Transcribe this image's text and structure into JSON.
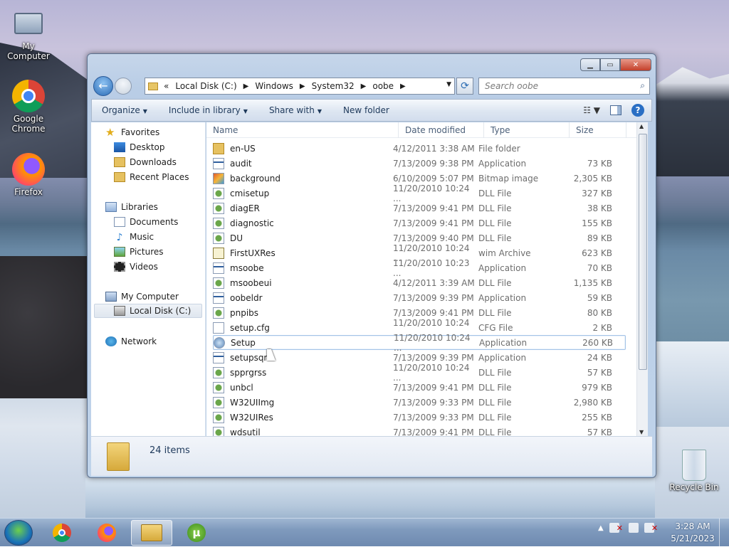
{
  "desktop": {
    "icons": [
      {
        "label": "My Computer",
        "icon": "computer-icon"
      },
      {
        "label": "Google\nChrome",
        "icon": "chrome-icon"
      },
      {
        "label": "Firefox",
        "icon": "firefox-icon"
      },
      {
        "label": "Recycle Bin",
        "icon": "recycle-bin-icon"
      }
    ]
  },
  "window": {
    "caption_buttons": [
      "minimize",
      "maximize",
      "close"
    ],
    "address": {
      "prefix": "«",
      "crumbs": [
        "Local Disk (C:)",
        "Windows",
        "System32",
        "oobe"
      ]
    },
    "search": {
      "placeholder": "Search oobe"
    },
    "toolbar": {
      "organize": "Organize",
      "include_in_library": "Include in library",
      "share_with": "Share with",
      "new_folder": "New folder"
    },
    "nav": {
      "favorites": "Favorites",
      "desktop": "Desktop",
      "downloads": "Downloads",
      "recent_places": "Recent Places",
      "libraries": "Libraries",
      "documents": "Documents",
      "music": "Music",
      "pictures": "Pictures",
      "videos": "Videos",
      "my_computer": "My Computer",
      "local_disk": "Local Disk (C:)",
      "network": "Network"
    },
    "columns": {
      "name": "Name",
      "date": "Date modified",
      "type": "Type",
      "size": "Size"
    },
    "files": [
      {
        "name": "en-US",
        "date": "4/12/2011 3:38 AM",
        "type": "File folder",
        "size": "",
        "icon": "folder"
      },
      {
        "name": "audit",
        "date": "7/13/2009 9:38 PM",
        "type": "Application",
        "size": "73 KB",
        "icon": "app"
      },
      {
        "name": "background",
        "date": "6/10/2009 5:07 PM",
        "type": "Bitmap image",
        "size": "2,305 KB",
        "icon": "bmp"
      },
      {
        "name": "cmisetup",
        "date": "11/20/2010 10:24 ...",
        "type": "DLL File",
        "size": "327 KB",
        "icon": "dll"
      },
      {
        "name": "diagER",
        "date": "7/13/2009 9:41 PM",
        "type": "DLL File",
        "size": "38 KB",
        "icon": "dll"
      },
      {
        "name": "diagnostic",
        "date": "7/13/2009 9:41 PM",
        "type": "DLL File",
        "size": "155 KB",
        "icon": "dll"
      },
      {
        "name": "DU",
        "date": "7/13/2009 9:40 PM",
        "type": "DLL File",
        "size": "89 KB",
        "icon": "dll"
      },
      {
        "name": "FirstUXRes",
        "date": "11/20/2010 10:24 ...",
        "type": "wim Archive",
        "size": "623 KB",
        "icon": "wim"
      },
      {
        "name": "msoobe",
        "date": "11/20/2010 10:23 ...",
        "type": "Application",
        "size": "70 KB",
        "icon": "app"
      },
      {
        "name": "msoobeui",
        "date": "4/12/2011 3:39 AM",
        "type": "DLL File",
        "size": "1,135 KB",
        "icon": "dll"
      },
      {
        "name": "oobeldr",
        "date": "7/13/2009 9:39 PM",
        "type": "Application",
        "size": "59 KB",
        "icon": "app"
      },
      {
        "name": "pnpibs",
        "date": "7/13/2009 9:41 PM",
        "type": "DLL File",
        "size": "80 KB",
        "icon": "dll"
      },
      {
        "name": "setup.cfg",
        "date": "11/20/2010 10:24 ...",
        "type": "CFG File",
        "size": "2 KB",
        "icon": "cfg"
      },
      {
        "name": "Setup",
        "date": "11/20/2010 10:24 ...",
        "type": "Application",
        "size": "260 KB",
        "icon": "setup"
      },
      {
        "name": "setupsqm",
        "date": "7/13/2009 9:39 PM",
        "type": "Application",
        "size": "24 KB",
        "icon": "app"
      },
      {
        "name": "spprgrss",
        "date": "11/20/2010 10:24 ...",
        "type": "DLL File",
        "size": "57 KB",
        "icon": "dll"
      },
      {
        "name": "unbcl",
        "date": "7/13/2009 9:41 PM",
        "type": "DLL File",
        "size": "979 KB",
        "icon": "dll"
      },
      {
        "name": "W32UIImg",
        "date": "7/13/2009 9:33 PM",
        "type": "DLL File",
        "size": "2,980 KB",
        "icon": "dll"
      },
      {
        "name": "W32UIRes",
        "date": "7/13/2009 9:33 PM",
        "type": "DLL File",
        "size": "255 KB",
        "icon": "dll"
      },
      {
        "name": "wdsutil",
        "date": "7/13/2009 9:41 PM",
        "type": "DLL File",
        "size": "57 KB",
        "icon": "dll"
      }
    ],
    "hovered_file": "Setup",
    "status": {
      "item_count": "24 items"
    }
  },
  "taskbar": {
    "pinned": [
      "windows-start-icon",
      "chrome-icon",
      "firefox-icon",
      "explorer-icon",
      "utorrent-icon"
    ],
    "active": "explorer-icon",
    "tray_icons": [
      "show-hidden-icons",
      "action-center-icon",
      "network-icon",
      "volume-muted-icon"
    ],
    "time": "3:28 AM",
    "date": "5/21/2023"
  }
}
